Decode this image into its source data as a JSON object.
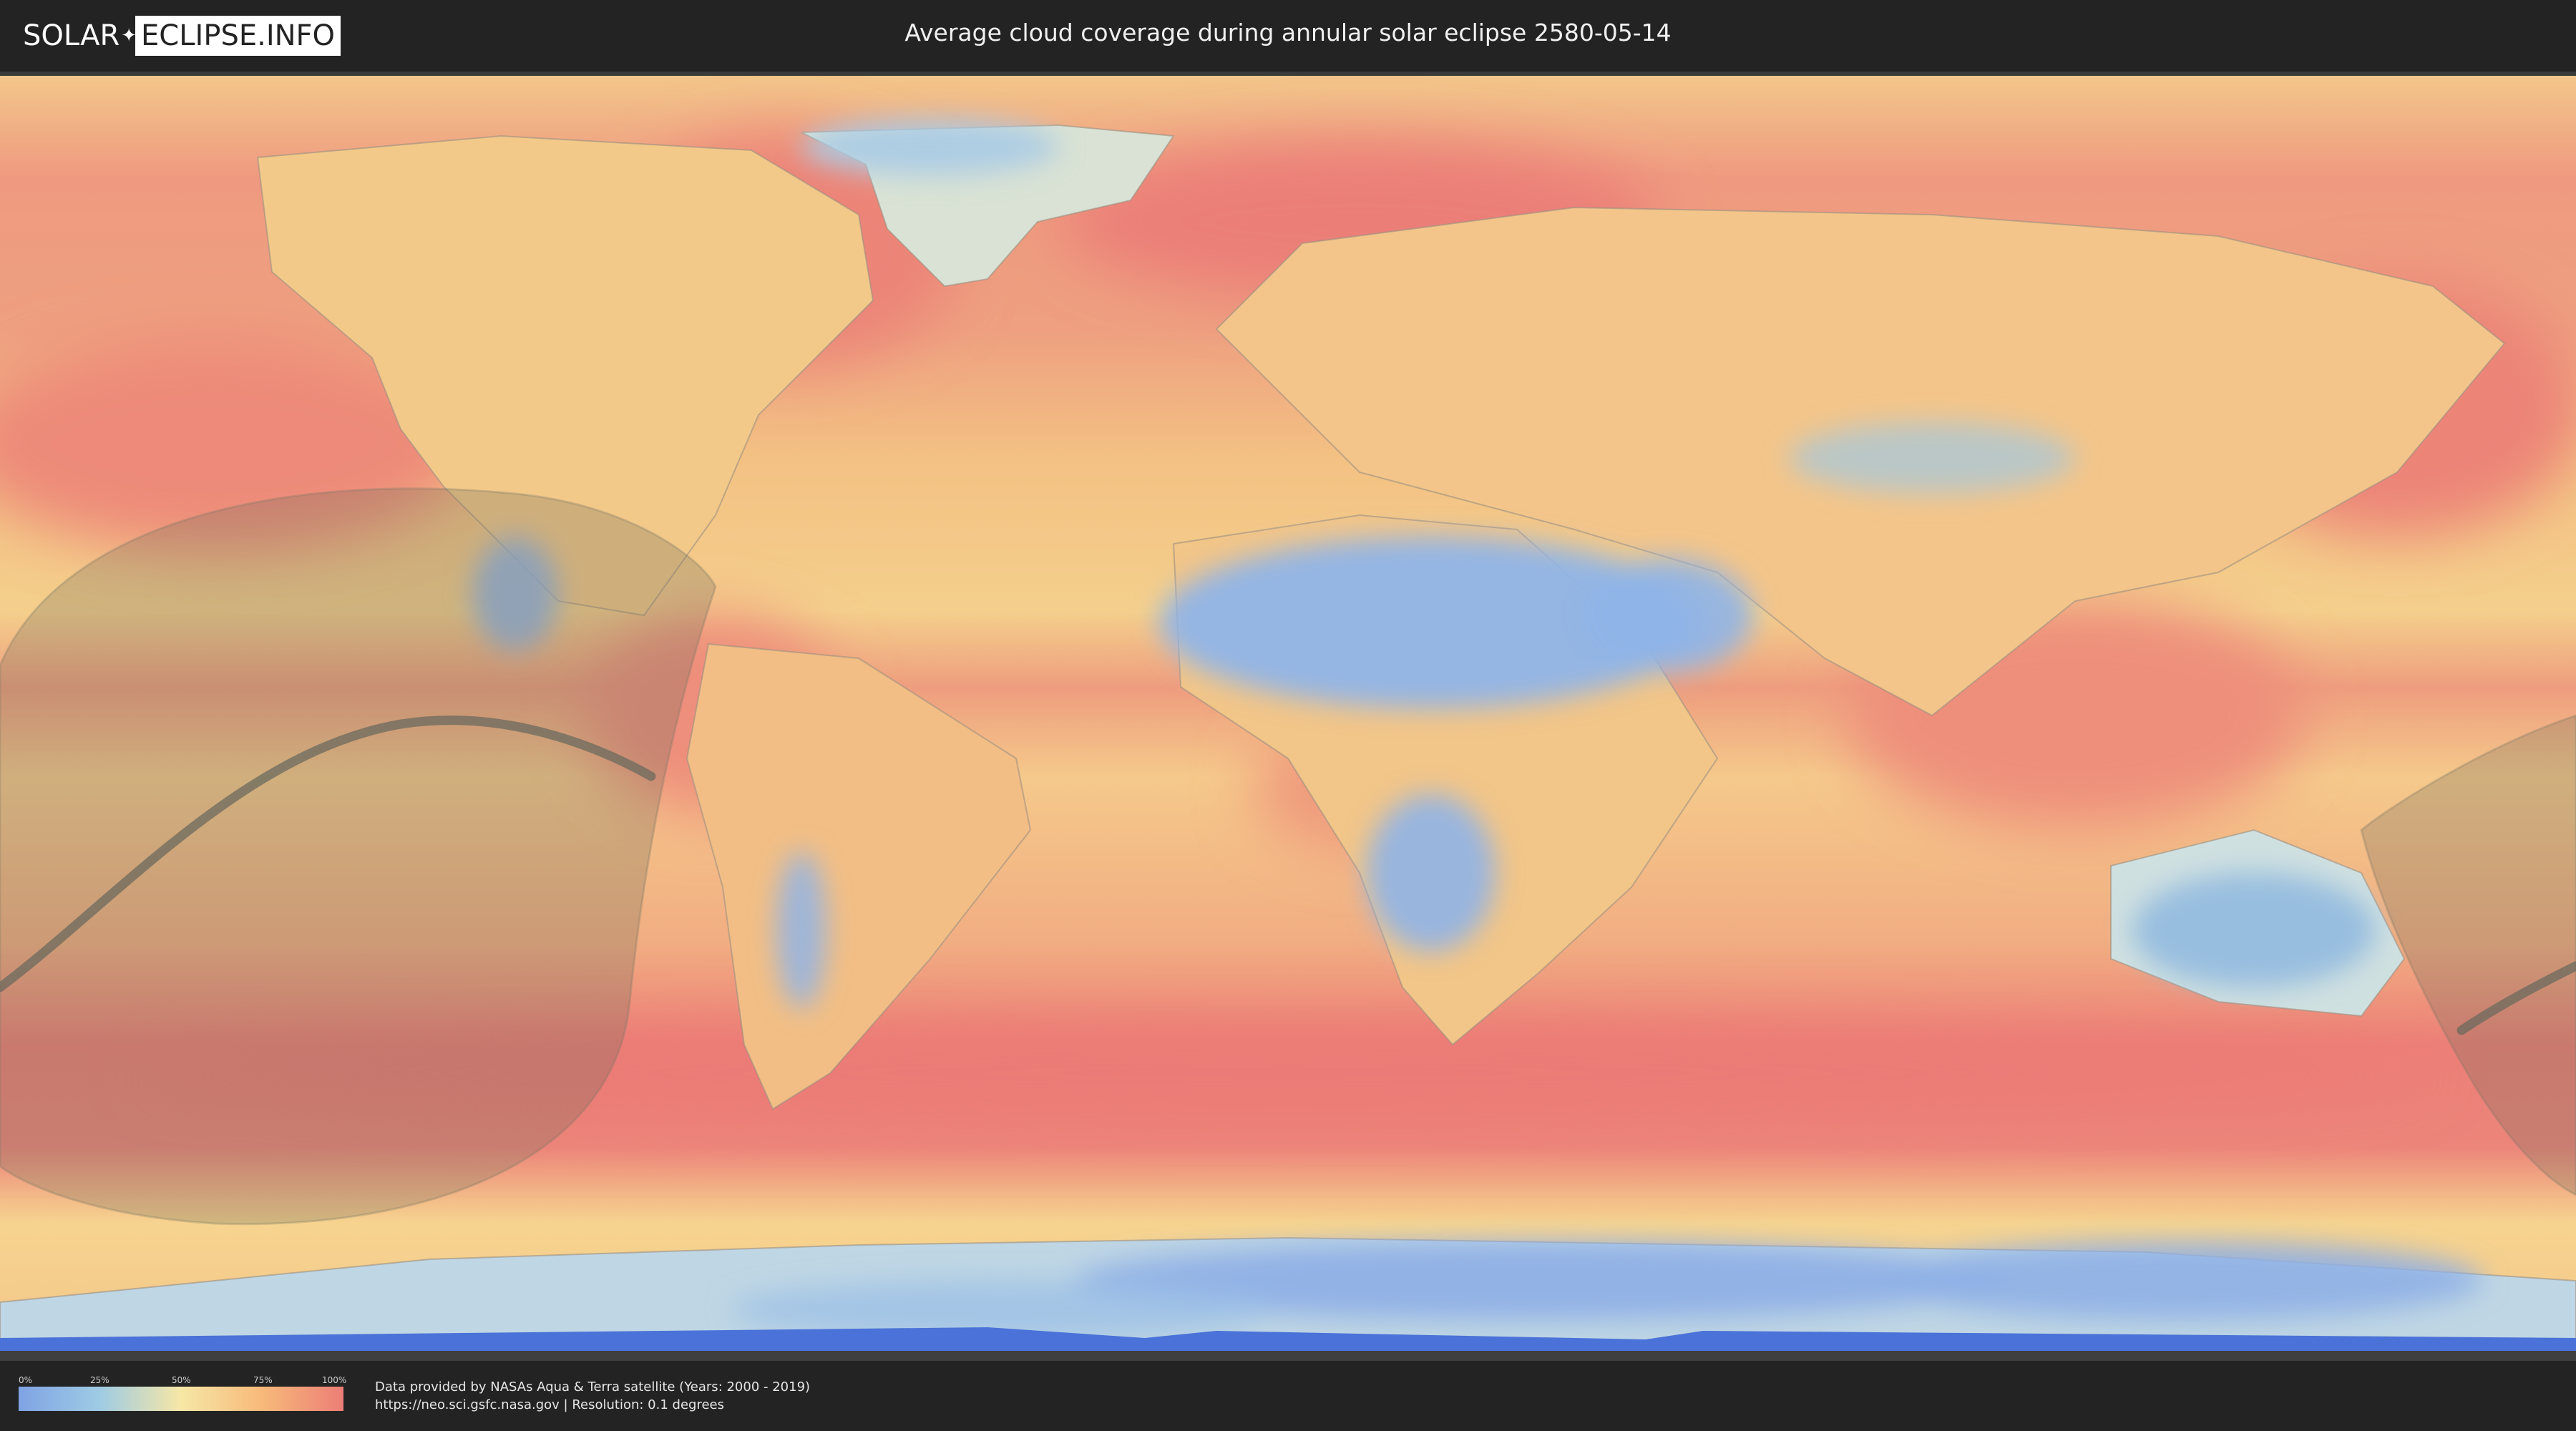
{
  "header": {
    "logo_left": "SOLAR",
    "logo_right": "ECLIPSE.INFO",
    "title": "Average cloud coverage during annular solar eclipse 2580-05-14"
  },
  "legend": {
    "ticks": [
      "0%",
      "25%",
      "50%",
      "75%",
      "100%"
    ],
    "colors": [
      "#7fa3e4",
      "#9fcbe4",
      "#f6e7a6",
      "#f7b97a",
      "#ec7e76"
    ]
  },
  "credits": {
    "line1": "Data provided by NASAs Aqua & Terra satellite (Years: 2000 - 2019)",
    "line2": "https://neo.sci.gsfc.nasa.gov | Resolution: 0.1 degrees"
  }
}
